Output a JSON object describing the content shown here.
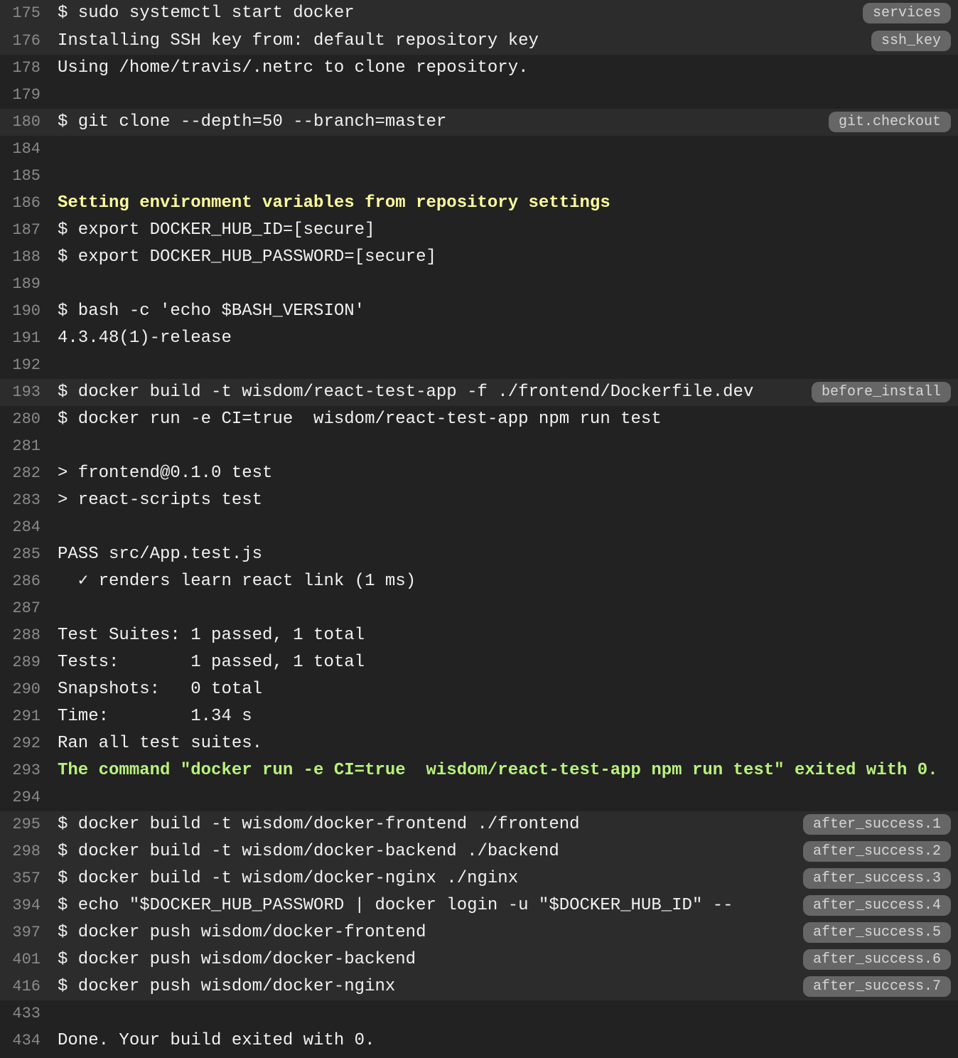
{
  "log": {
    "lines": [
      {
        "num": "175",
        "text": "$ sudo systemctl start docker",
        "tag": "services",
        "fold": true,
        "style": "",
        "first": true
      },
      {
        "num": "176",
        "text": "Installing SSH key from: default repository key",
        "tag": "ssh_key",
        "fold": true,
        "style": ""
      },
      {
        "num": "178",
        "text": "Using /home/travis/.netrc to clone repository.",
        "tag": "",
        "fold": false,
        "style": ""
      },
      {
        "num": "179",
        "text": "",
        "tag": "",
        "fold": false,
        "style": ""
      },
      {
        "num": "180",
        "text": "$ git clone --depth=50 --branch=master",
        "tag": "git.checkout",
        "fold": true,
        "style": ""
      },
      {
        "num": "184",
        "text": "",
        "tag": "",
        "fold": false,
        "style": ""
      },
      {
        "num": "185",
        "text": "",
        "tag": "",
        "fold": false,
        "style": ""
      },
      {
        "num": "186",
        "text": "Setting environment variables from repository settings",
        "tag": "",
        "fold": false,
        "style": "yellow"
      },
      {
        "num": "187",
        "text": "$ export DOCKER_HUB_ID=[secure]",
        "tag": "",
        "fold": false,
        "style": ""
      },
      {
        "num": "188",
        "text": "$ export DOCKER_HUB_PASSWORD=[secure]",
        "tag": "",
        "fold": false,
        "style": ""
      },
      {
        "num": "189",
        "text": "",
        "tag": "",
        "fold": false,
        "style": ""
      },
      {
        "num": "190",
        "text": "$ bash -c 'echo $BASH_VERSION'",
        "tag": "",
        "fold": false,
        "style": ""
      },
      {
        "num": "191",
        "text": "4.3.48(1)-release",
        "tag": "",
        "fold": false,
        "style": ""
      },
      {
        "num": "192",
        "text": "",
        "tag": "",
        "fold": false,
        "style": ""
      },
      {
        "num": "193",
        "text": "$ docker build -t wisdom/react-test-app -f ./frontend/Dockerfile.dev",
        "tag": "before_install",
        "fold": true,
        "style": ""
      },
      {
        "num": "280",
        "text": "$ docker run -e CI=true  wisdom/react-test-app npm run test",
        "tag": "",
        "fold": false,
        "style": ""
      },
      {
        "num": "281",
        "text": "",
        "tag": "",
        "fold": false,
        "style": ""
      },
      {
        "num": "282",
        "text": "> frontend@0.1.0 test",
        "tag": "",
        "fold": false,
        "style": ""
      },
      {
        "num": "283",
        "text": "> react-scripts test",
        "tag": "",
        "fold": false,
        "style": ""
      },
      {
        "num": "284",
        "text": "",
        "tag": "",
        "fold": false,
        "style": ""
      },
      {
        "num": "285",
        "text": "PASS src/App.test.js",
        "tag": "",
        "fold": false,
        "style": ""
      },
      {
        "num": "286",
        "text": "  ✓ renders learn react link (1 ms)",
        "tag": "",
        "fold": false,
        "style": ""
      },
      {
        "num": "287",
        "text": "",
        "tag": "",
        "fold": false,
        "style": ""
      },
      {
        "num": "288",
        "text": "Test Suites: 1 passed, 1 total",
        "tag": "",
        "fold": false,
        "style": ""
      },
      {
        "num": "289",
        "text": "Tests:       1 passed, 1 total",
        "tag": "",
        "fold": false,
        "style": ""
      },
      {
        "num": "290",
        "text": "Snapshots:   0 total",
        "tag": "",
        "fold": false,
        "style": ""
      },
      {
        "num": "291",
        "text": "Time:        1.34 s",
        "tag": "",
        "fold": false,
        "style": ""
      },
      {
        "num": "292",
        "text": "Ran all test suites.",
        "tag": "",
        "fold": false,
        "style": ""
      },
      {
        "num": "293",
        "text": "The command \"docker run -e CI=true  wisdom/react-test-app npm run test\" exited with 0.",
        "tag": "",
        "fold": false,
        "style": "green"
      },
      {
        "num": "294",
        "text": "",
        "tag": "",
        "fold": false,
        "style": ""
      },
      {
        "num": "295",
        "text": "$ docker build -t wisdom/docker-frontend ./frontend",
        "tag": "after_success.1",
        "fold": true,
        "style": ""
      },
      {
        "num": "298",
        "text": "$ docker build -t wisdom/docker-backend ./backend",
        "tag": "after_success.2",
        "fold": true,
        "style": ""
      },
      {
        "num": "357",
        "text": "$ docker build -t wisdom/docker-nginx ./nginx",
        "tag": "after_success.3",
        "fold": true,
        "style": ""
      },
      {
        "num": "394",
        "text": "$ echo \"$DOCKER_HUB_PASSWORD | docker login -u \"$DOCKER_HUB_ID\" --",
        "tag": "after_success.4",
        "fold": true,
        "style": ""
      },
      {
        "num": "397",
        "text": "$ docker push wisdom/docker-frontend",
        "tag": "after_success.5",
        "fold": true,
        "style": ""
      },
      {
        "num": "401",
        "text": "$ docker push wisdom/docker-backend",
        "tag": "after_success.6",
        "fold": true,
        "style": ""
      },
      {
        "num": "416",
        "text": "$ docker push wisdom/docker-nginx",
        "tag": "after_success.7",
        "fold": true,
        "style": ""
      },
      {
        "num": "433",
        "text": "",
        "tag": "",
        "fold": false,
        "style": ""
      },
      {
        "num": "434",
        "text": "Done. Your build exited with 0.",
        "tag": "",
        "fold": false,
        "style": ""
      }
    ]
  }
}
